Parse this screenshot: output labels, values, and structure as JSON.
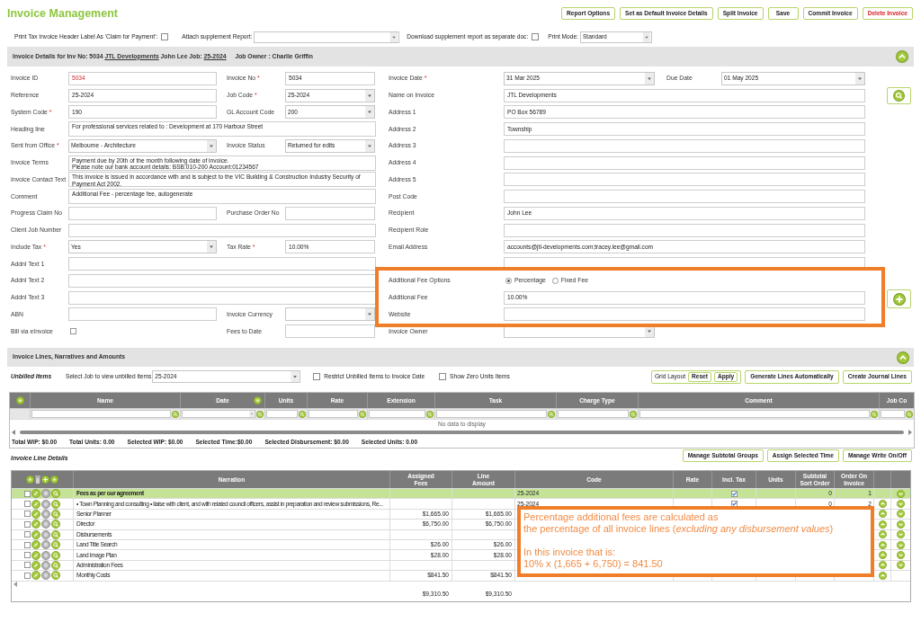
{
  "app": {
    "title": "Invoice Management"
  },
  "toolbar": [
    {
      "label": "Report Options",
      "kind": "normal"
    },
    {
      "label": "Set as Default Invoice Details",
      "kind": "normal"
    },
    {
      "label": "Split Invoice",
      "kind": "normal"
    },
    {
      "label": "Save",
      "kind": "normal"
    },
    {
      "label": "Commit Invoice",
      "kind": "normal"
    },
    {
      "label": "Delete Invoice",
      "kind": "danger"
    }
  ],
  "print_options": [
    {
      "kind": "checkbox",
      "label": "Print Tax Invoice Header Label As 'Claim for Payment':",
      "checked": false
    },
    {
      "kind": "select",
      "label": "Attach supplement Report:"
    },
    {
      "kind": "checkbox",
      "label": "Download supplement report as separate doc:",
      "checked": false
    },
    {
      "kind": "select",
      "label": "Print Mode:",
      "value": "Standard"
    }
  ],
  "invoice_details": {
    "expanded": true,
    "header": [
      {
        "kind": "text",
        "text": "Invoice Details for Inv No: 5034"
      },
      {
        "kind": "link",
        "text": "JTL Developments"
      },
      {
        "kind": "text",
        "text": "John Lee Job:"
      },
      {
        "kind": "link",
        "text": "25-2024"
      },
      {
        "kind": "text",
        "text": "Job Owner : Charlie Griffin"
      }
    ],
    "left_rows": [
      {
        "fields": [
          {
            "label": "Invoice ID",
            "kind": "readonly",
            "value": "5034"
          },
          {
            "label": "Invoice No",
            "marker": "*",
            "kind": "text",
            "value": "5034"
          }
        ]
      },
      {
        "fields": [
          {
            "label": "Reference",
            "kind": "text",
            "value": "25-2024"
          },
          {
            "label": "Job Code",
            "marker": "*",
            "kind": "select",
            "value": "25-2024"
          }
        ]
      },
      {
        "fields": [
          {
            "label": "System Code",
            "marker": "*",
            "kind": "text",
            "value": "190"
          },
          {
            "label": "GL Account Code",
            "kind": "select",
            "value": "200"
          }
        ]
      },
      {
        "fields": [
          {
            "label": "Heading line",
            "kind": "textarea",
            "value": "For professional services related to :  Development at 170 Harbour Street"
          }
        ]
      },
      {
        "fields": [
          {
            "label": "Sent from Office",
            "marker": "*",
            "kind": "select",
            "value": "Melbourne - Architecture"
          },
          {
            "label": "Invoice Status",
            "kind": "select",
            "value": "Returned for edits"
          }
        ]
      },
      {
        "fields": [
          {
            "label": "Invoice Terms",
            "kind": "textarea",
            "lines": [
              "Payment due by 20th of the month following date of invoice.",
              "Please note our bank account details: BSB:010-200 Account:01234567"
            ]
          }
        ]
      },
      {
        "fields": [
          {
            "label": "Invoice Contact Text",
            "kind": "textarea",
            "value": "This invoice is issued in accordance with and is subject to the VIC Building & Construction Industry Security of Payment Act 2002."
          }
        ]
      },
      {
        "fields": [
          {
            "label": "Comment",
            "kind": "textarea",
            "value": "Additional Fee - percentage fee, autogenerate"
          }
        ]
      },
      {
        "fields": [
          {
            "label": "Progress Claim No",
            "kind": "text"
          },
          {
            "label": "Purchase Order No",
            "kind": "text"
          }
        ]
      },
      {
        "fields": [
          {
            "label": "Client Job Number",
            "kind": "text"
          }
        ]
      },
      {
        "fields": [
          {
            "label": "Include Tax",
            "marker": "*",
            "kind": "select",
            "value": "Yes"
          },
          {
            "label": "Tax Rate",
            "marker": "*",
            "kind": "text",
            "value": "10.00%"
          }
        ]
      },
      {
        "fields": [
          {
            "label": "Addnl Text 1",
            "kind": "text"
          }
        ]
      },
      {
        "fields": [
          {
            "label": "Addnl Text 2",
            "kind": "text"
          }
        ]
      },
      {
        "fields": [
          {
            "label": "Addnl Text 3",
            "kind": "text"
          }
        ]
      },
      {
        "fields": [
          {
            "label": "ABN",
            "kind": "text"
          },
          {
            "label": "Invoice Currency",
            "kind": "select"
          }
        ]
      },
      {
        "fields": [
          {
            "label": "Bill via eInvoice",
            "kind": "checkbox",
            "checked": false
          },
          {
            "label": "Fees to Date",
            "kind": "text"
          }
        ]
      }
    ],
    "right_rows": [
      {
        "fields": [
          {
            "label": "Invoice Date",
            "marker": "*",
            "kind": "select",
            "value": "31 Mar 2025"
          },
          {
            "label": "Due Date",
            "kind": "select",
            "value": "01 May 2025"
          }
        ]
      },
      {
        "fields": [
          {
            "label": "Name on Invoice",
            "kind": "text",
            "value": "JTL Developments"
          }
        ]
      },
      {
        "fields": [
          {
            "label": "Address 1",
            "kind": "text",
            "value": "PO Box 56789"
          }
        ]
      },
      {
        "fields": [
          {
            "label": "Address 2",
            "kind": "text",
            "value": "Township"
          }
        ]
      },
      {
        "fields": [
          {
            "label": "Address 3",
            "kind": "text"
          }
        ]
      },
      {
        "fields": [
          {
            "label": "Address 4",
            "kind": "text"
          }
        ]
      },
      {
        "fields": [
          {
            "label": "Address 5",
            "kind": "text"
          }
        ]
      },
      {
        "fields": [
          {
            "label": "Post Code",
            "kind": "text"
          }
        ]
      },
      {
        "fields": [
          {
            "label": "Recipient",
            "kind": "text",
            "value": "John Lee"
          }
        ]
      },
      {
        "fields": [
          {
            "label": "Recipient Role",
            "kind": "text"
          }
        ]
      },
      {
        "fields": [
          {
            "label": "Email Address",
            "kind": "text",
            "value": "accounts@jtl-developments.com;tracey.lee@gmail.com"
          }
        ]
      },
      {
        "fields": [
          {
            "kind": "text"
          }
        ]
      },
      {
        "fields": [
          {
            "label": "Additional Fee Options",
            "kind": "radio",
            "options": [
              {
                "label": "Percentage",
                "selected": true
              },
              {
                "label": "Fixed Fee",
                "selected": false
              }
            ]
          }
        ]
      },
      {
        "fields": [
          {
            "label": "Additional Fee",
            "kind": "text",
            "value": "10.00%"
          }
        ]
      },
      {
        "fields": [
          {
            "label": "Website",
            "kind": "text"
          }
        ]
      },
      {
        "fields": [
          {
            "label": "Invoice Owner",
            "kind": "select"
          }
        ]
      }
    ]
  },
  "invoice_lines": {
    "title": "Invoice Lines, Narratives and Amounts",
    "expanded": true,
    "unbilled": {
      "title": "Unbilled Items",
      "job_label": "Select Job to view unbilled items",
      "job_value": "25-2024",
      "options": [
        {
          "label": "Restrict Unbilled Items to Invoice Date",
          "checked": false
        },
        {
          "label": "Show Zero Units Items",
          "checked": false
        }
      ]
    },
    "grid_layout": {
      "label": "Grid Layout",
      "buttons": [
        "Reset",
        "Apply"
      ]
    },
    "actions": [
      "Generate Lines Automatically",
      "Create Journal Lines"
    ],
    "unbilled_grid": {
      "columns": [
        {
          "label": "Name",
          "kind": "text"
        },
        {
          "label": "Date",
          "kind": "date"
        },
        {
          "label": "Units",
          "kind": "text"
        },
        {
          "label": "Rate",
          "kind": "text"
        },
        {
          "label": "Extension",
          "kind": "text"
        },
        {
          "label": "Task",
          "kind": "text"
        },
        {
          "label": "Charge Type",
          "kind": "text"
        },
        {
          "label": "Comment",
          "kind": "text"
        },
        {
          "label": "Job Co",
          "kind": "text"
        }
      ],
      "empty_message": "No data to display",
      "totals": [
        "Total WIP: $0.00",
        "Total Units: 0.00",
        "Selected WIP: $0.00",
        "Selected Time:$0.00",
        "Selected Disbursement: $0.00",
        "Selected Units: 0.00"
      ]
    },
    "line_details": {
      "title": "Invoice Line Details",
      "actions": [
        "Manage Subtotal Groups",
        "Assign Selected Time",
        "Manage Write On/Off"
      ],
      "columns": [
        "Narration",
        "Assigned Fees",
        "Line Amount",
        "Code",
        "Rate",
        "Incl. Tax",
        "Units",
        "Subtotal Sort Order",
        "Order On Invoice"
      ],
      "rows": [
        {
          "narration": "Fees as per our agreement",
          "selected": true,
          "checked": false,
          "code": "25-2024",
          "incl_tax": true,
          "sort_order": "0",
          "order": "1",
          "can_move_up": false,
          "can_move_down": true
        },
        {
          "narration": "• Town Planning and consulting • liaise with client, and with related council officers, assist in preparation and review submissions, Re...",
          "selected": false,
          "checked": false,
          "code": "25-2024",
          "incl_tax": true,
          "sort_order": "0",
          "order": "2",
          "can_move_up": true,
          "can_move_down": true
        },
        {
          "narration": "Senior Planner",
          "selected": false,
          "checked": false,
          "assigned_fees": "$1,665.00",
          "line_amount": "$1,665.00",
          "can_move_up": true,
          "can_move_down": true
        },
        {
          "narration": "Director",
          "selected": false,
          "checked": false,
          "assigned_fees": "$6,750.00",
          "line_amount": "$6,750.00",
          "can_move_up": true,
          "can_move_down": true
        },
        {
          "narration": "Disbursements",
          "selected": false,
          "checked": false,
          "can_move_up": true,
          "can_move_down": true
        },
        {
          "narration": "Land Title Search",
          "selected": false,
          "checked": false,
          "assigned_fees": "$26.00",
          "line_amount": "$26.00",
          "can_move_up": true,
          "can_move_down": true
        },
        {
          "narration": "Land Image Plan",
          "selected": false,
          "checked": false,
          "assigned_fees": "$28.00",
          "line_amount": "$28.00",
          "can_move_up": true,
          "can_move_down": true
        },
        {
          "narration": "Administration Fees",
          "selected": false,
          "checked": false,
          "can_move_up": true,
          "can_move_down": true
        },
        {
          "narration": "Monthly Costs",
          "selected": false,
          "checked": false,
          "assigned_fees": "$841.50",
          "line_amount": "$841.50",
          "can_move_up": true,
          "can_move_down": false
        }
      ],
      "totals": {
        "assigned_fees": "$9,310.50",
        "line_amount": "$9,310.50"
      }
    },
    "callout": {
      "paragraphs": [
        [
          "Percentage additional fees are calculated as",
          "the percentage of all invoice lines (*excluding any disbursement values*)"
        ],
        [
          "In this invoice that is:",
          "10% x (1,665 + 6,750) = 841.50"
        ]
      ]
    }
  }
}
